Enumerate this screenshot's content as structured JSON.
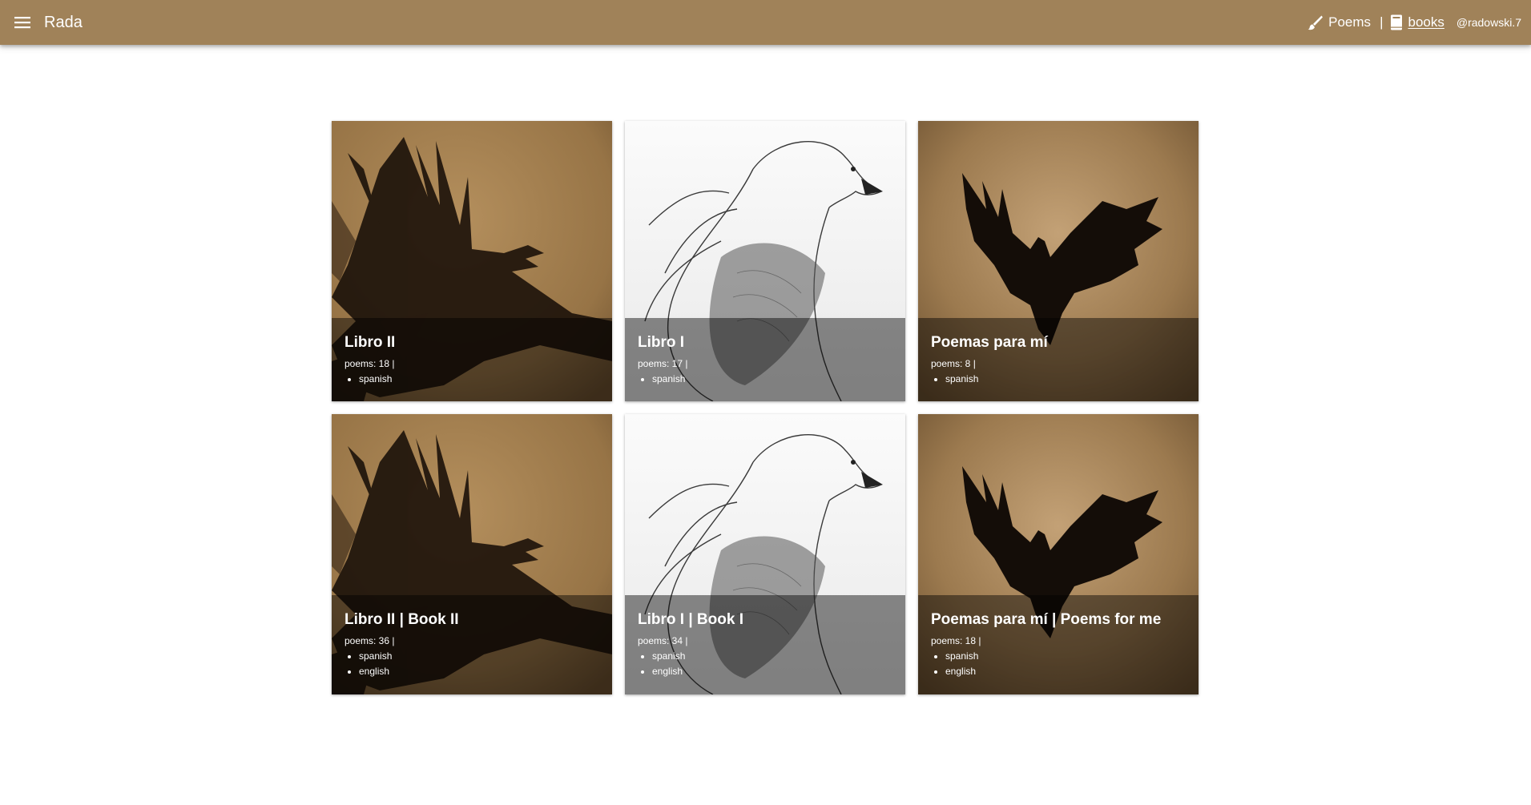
{
  "appbar": {
    "title": "Rada",
    "menu_icon": "menu-icon",
    "nav": {
      "poems_label": "Poems",
      "poems_icon": "brush-icon",
      "separator": "|",
      "books_label": "books",
      "books_icon": "book-icon",
      "user": "@radowski.7"
    },
    "color": "#a08259"
  },
  "books": [
    {
      "title": "Libro II",
      "count": "poems: 18 |",
      "languages": [
        "spanish"
      ],
      "art": "crow-sepia"
    },
    {
      "title": "Libro I",
      "count": "poems: 17 |",
      "languages": [
        "spanish"
      ],
      "art": "eagle-sketch"
    },
    {
      "title": "Poemas para mí",
      "count": "poems: 8 |",
      "languages": [
        "spanish"
      ],
      "art": "crow-sky"
    },
    {
      "title": "Libro II | Book II",
      "count": "poems: 36 |",
      "languages": [
        "spanish",
        "english"
      ],
      "art": "crow-sepia"
    },
    {
      "title": "Libro I | Book I",
      "count": "poems: 34 |",
      "languages": [
        "spanish",
        "english"
      ],
      "art": "eagle-sketch"
    },
    {
      "title": "Poemas para mí | Poems for me",
      "count": "poems: 18 |",
      "languages": [
        "spanish",
        "english"
      ],
      "art": "crow-sky"
    }
  ]
}
